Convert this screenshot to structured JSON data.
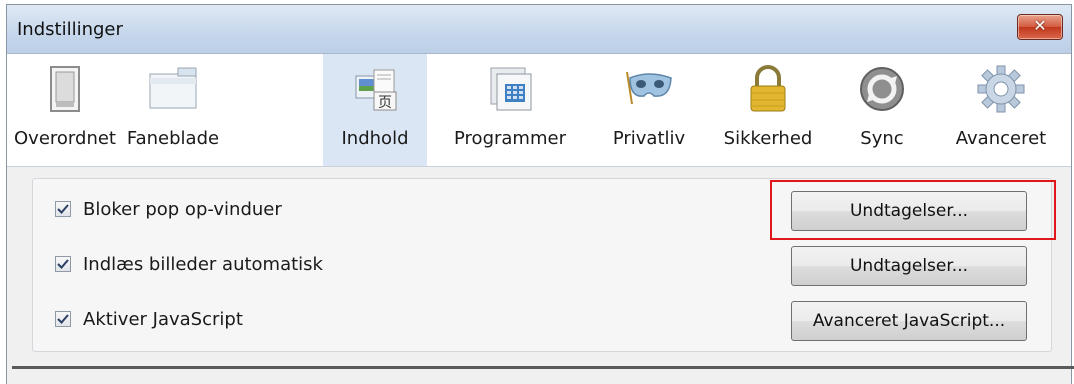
{
  "window": {
    "title": "Indstillinger",
    "close_label": "✕"
  },
  "toolbar": {
    "panes": [
      {
        "label": "Overordnet",
        "icon": "switch-icon"
      },
      {
        "label": "Faneblade",
        "icon": "folder-tabs-icon"
      },
      {
        "label": "Indhold",
        "icon": "content-icon",
        "selected": true
      },
      {
        "label": "Programmer",
        "icon": "applications-icon"
      },
      {
        "label": "Privatliv",
        "icon": "mask-icon"
      },
      {
        "label": "Sikkerhed",
        "icon": "padlock-icon"
      },
      {
        "label": "Sync",
        "icon": "sync-icon"
      },
      {
        "label": "Avanceret",
        "icon": "gear-icon"
      }
    ]
  },
  "content": {
    "rows": [
      {
        "label": "Bloker pop op-vinduer",
        "checked": true,
        "button": "Undtagelser..."
      },
      {
        "label": "Indlæs billeder automatisk",
        "checked": true,
        "button": "Undtagelser..."
      },
      {
        "label": "Aktiver JavaScript",
        "checked": true,
        "button": "Avanceret JavaScript..."
      }
    ]
  },
  "colors": {
    "selected_pane": "#dbe6f4",
    "highlight": "#e0181b"
  }
}
